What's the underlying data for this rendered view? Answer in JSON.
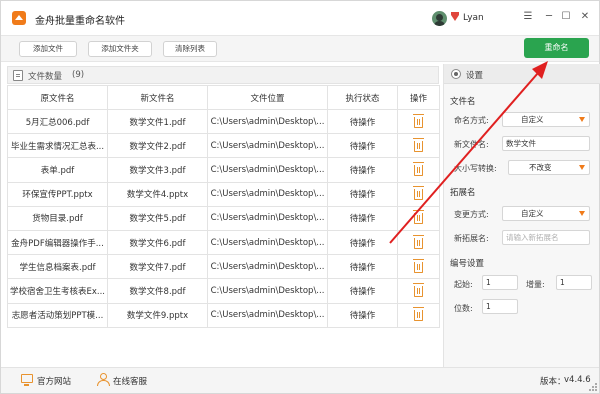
{
  "app": {
    "title": "金舟批量重命名软件"
  },
  "user": {
    "name": "Lyan"
  },
  "window_controls": {
    "menu": "☰",
    "minimize": "─",
    "maximize": "☐",
    "close": "✕"
  },
  "toolbar": {
    "add_file": "添加文件",
    "add_folder": "添加文件夹",
    "clear_list": "清除列表",
    "rename": "重命名"
  },
  "list": {
    "header_label": "文件数量",
    "count": "(9)",
    "columns": [
      "原文件名",
      "新文件名",
      "文件位置",
      "执行状态",
      "操作"
    ],
    "rows": [
      {
        "original": "5月汇总006.pdf",
        "new": "数学文件1.pdf",
        "path": "C:\\Users\\admin\\Desktop\\...",
        "status": "待操作"
      },
      {
        "original": "毕业生需求情况汇总表...",
        "new": "数学文件2.pdf",
        "path": "C:\\Users\\admin\\Desktop\\...",
        "status": "待操作"
      },
      {
        "original": "表单.pdf",
        "new": "数学文件3.pdf",
        "path": "C:\\Users\\admin\\Desktop\\...",
        "status": "待操作"
      },
      {
        "original": "环保宣传PPT.pptx",
        "new": "数学文件4.pptx",
        "path": "C:\\Users\\admin\\Desktop\\...",
        "status": "待操作"
      },
      {
        "original": "货物目录.pdf",
        "new": "数学文件5.pdf",
        "path": "C:\\Users\\admin\\Desktop\\...",
        "status": "待操作"
      },
      {
        "original": "金舟PDF编辑器操作手...",
        "new": "数学文件6.pdf",
        "path": "C:\\Users\\admin\\Desktop\\...",
        "status": "待操作"
      },
      {
        "original": "学生信息档案表.pdf",
        "new": "数学文件7.pdf",
        "path": "C:\\Users\\admin\\Desktop\\...",
        "status": "待操作"
      },
      {
        "original": "学校宿舍卫生考核表Ex...",
        "new": "数学文件8.pdf",
        "path": "C:\\Users\\admin\\Desktop\\...",
        "status": "待操作"
      },
      {
        "original": "志愿者活动策划PPT模...",
        "new": "数学文件9.pptx",
        "path": "C:\\Users\\admin\\Desktop\\...",
        "status": "待操作"
      }
    ]
  },
  "settings": {
    "title": "设置",
    "file_name_section": "文件名",
    "naming_mode_label": "命名方式:",
    "naming_mode_value": "自定义",
    "new_name_label": "新文件名:",
    "new_name_value": "数学文件",
    "case_label": "大小写转换:",
    "case_value": "不改变",
    "ext_section": "拓展名",
    "ext_mode_label": "变更方式:",
    "ext_mode_value": "自定义",
    "new_ext_label": "新拓展名:",
    "new_ext_placeholder": "请输入新拓展名",
    "numbering_section": "编号设置",
    "start_label": "起始:",
    "start_value": "1",
    "step_label": "增量:",
    "step_value": "1",
    "digits_label": "位数:",
    "digits_value": "1"
  },
  "statusbar": {
    "website": "官方网站",
    "support": "在线客服",
    "version_label": "版本：",
    "version": "v4.4.6"
  },
  "colors": {
    "accent": "#2aa44f",
    "brand": "#f07b1a",
    "annotation": "#e02020"
  }
}
